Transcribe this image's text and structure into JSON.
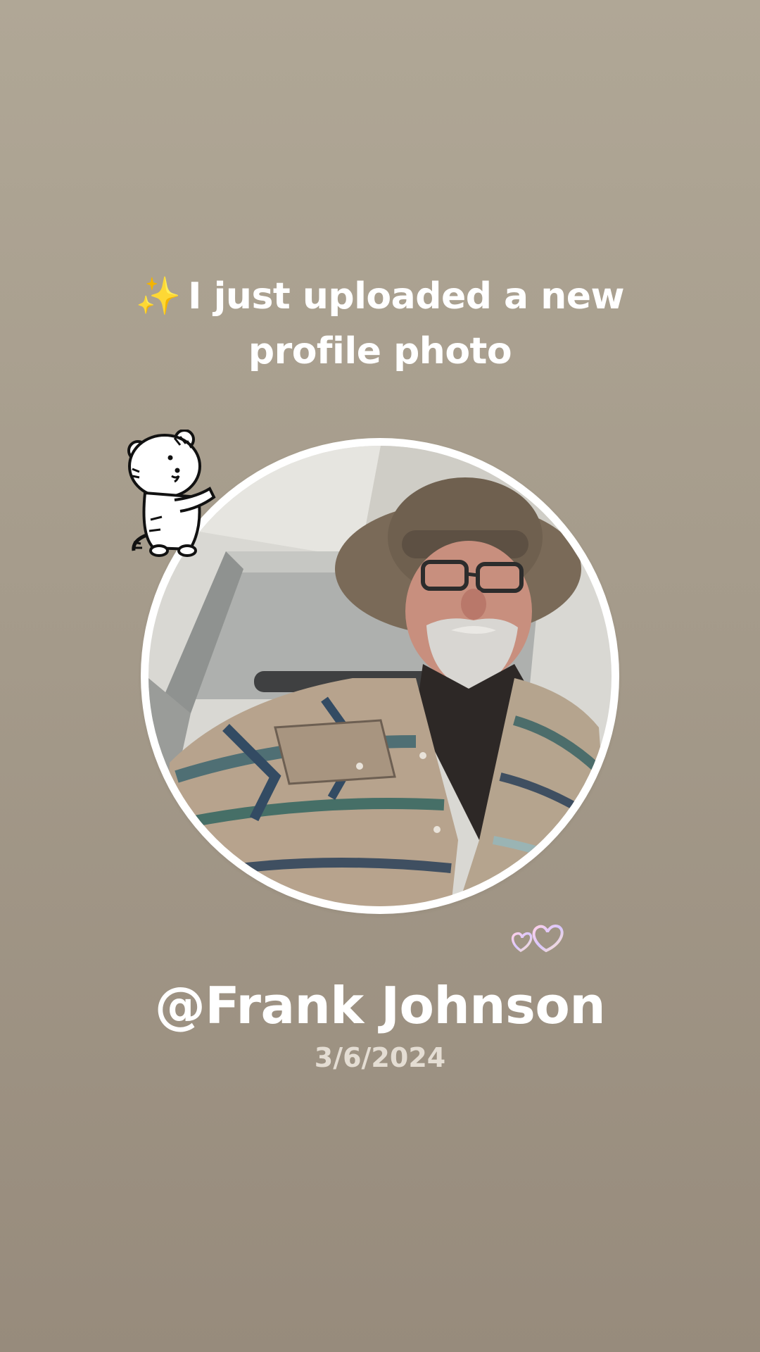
{
  "post": {
    "headline_emoji": "✨",
    "headline_line1": "I just uploaded a new",
    "headline_line2": "profile photo",
    "username": "@Frank Johnson",
    "date": "3/6/2024"
  },
  "stickers": {
    "top_left": "tiger-sticker",
    "bottom_right": "hearts-sticker"
  },
  "colors": {
    "background_top": "#b0a796",
    "background_bottom": "#978b7c",
    "text": "#ffffff",
    "date_text": "#e4ddd3"
  }
}
